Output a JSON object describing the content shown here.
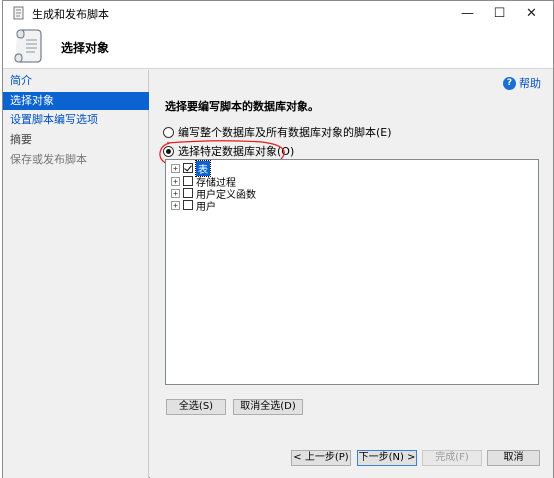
{
  "window": {
    "title": "生成和发布脚本",
    "controls": {
      "minimize": "—",
      "maximize": "☐",
      "close": "✕"
    }
  },
  "header": {
    "page_title": "选择对象",
    "icon": "script-scroll-icon"
  },
  "sidebar": {
    "items": [
      {
        "label": "简介",
        "state": "link"
      },
      {
        "label": "选择对象",
        "state": "active"
      },
      {
        "label": "设置脚本编写选项",
        "state": "link"
      },
      {
        "label": "摘要",
        "state": "plain"
      },
      {
        "label": "保存或发布脚本",
        "state": "disabled"
      }
    ]
  },
  "content": {
    "help_label": "帮助",
    "instruction": "选择要编写脚本的数据库对象。",
    "options": [
      {
        "label": "编写整个数据库及所有数据库对象的脚本(E)",
        "checked": false
      },
      {
        "label": "选择特定数据库对象(O)",
        "checked": true
      }
    ],
    "tree": [
      {
        "label": "表",
        "checked": true,
        "selected": true
      },
      {
        "label": "存储过程",
        "checked": false,
        "selected": false
      },
      {
        "label": "用户定义函数",
        "checked": false,
        "selected": false
      },
      {
        "label": "用户",
        "checked": false,
        "selected": false
      }
    ],
    "select_all": "全选(S)",
    "deselect_all": "取消全选(D)"
  },
  "footer": {
    "prev": "< 上一步(P)",
    "next": "下一步(N) >",
    "finish": "完成(F)",
    "cancel": "取消"
  },
  "colors": {
    "selection": "#0a63d0",
    "link": "#0050c0",
    "annotation": "#e0201c"
  }
}
